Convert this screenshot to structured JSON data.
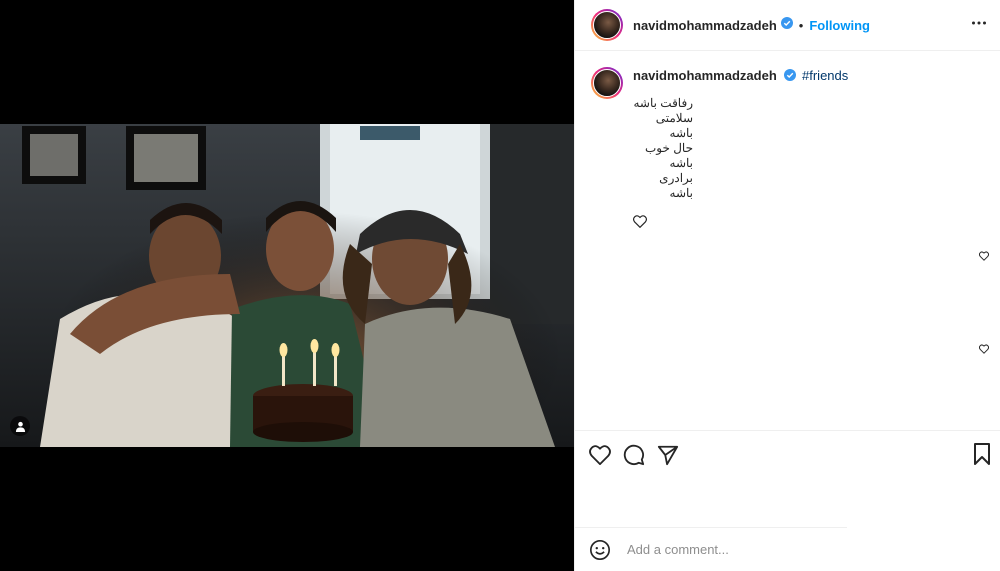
{
  "post": {
    "username": "navidmohammadzadeh",
    "follow_status": "Following",
    "separator": "•",
    "hashtag": "#friends",
    "caption_lines": [
      "رفاقت باشه",
      "سلامتی باشه",
      "حال خوب باشه",
      "برادری باشه"
    ]
  },
  "comment_box": {
    "placeholder": "Add a comment..."
  },
  "icons": {
    "verified": "verified-badge-icon",
    "more": "more-options-icon",
    "like": "heart-icon",
    "comment": "comment-icon",
    "share": "share-icon",
    "save": "bookmark-icon",
    "emoji": "emoji-icon",
    "tagged": "user-tag-icon"
  },
  "colors": {
    "accent": "#0095f6",
    "hashtag": "#00376b",
    "border": "#efefef",
    "text": "#262626"
  }
}
